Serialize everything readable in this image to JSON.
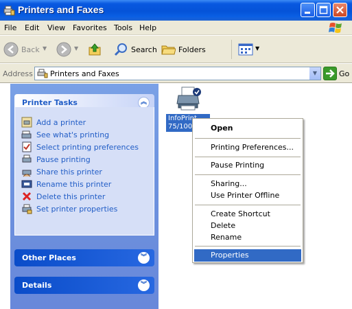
{
  "window": {
    "title": "Printers and Faxes",
    "icon": "printer-fax-icon"
  },
  "menu": {
    "items": [
      "File",
      "Edit",
      "View",
      "Favorites",
      "Tools",
      "Help"
    ]
  },
  "toolbar": {
    "back_label": "Back",
    "search_label": "Search",
    "folders_label": "Folders"
  },
  "address": {
    "label": "Address",
    "value": "Printers and Faxes",
    "go_label": "Go"
  },
  "left_panel": {
    "printer_tasks": {
      "title": "Printer Tasks",
      "items": [
        {
          "label": "Add a printer",
          "icon": "add-printer-icon"
        },
        {
          "label": "See what's printing",
          "icon": "print-queue-icon"
        },
        {
          "label": "Select printing preferences",
          "icon": "preferences-icon"
        },
        {
          "label": "Pause printing",
          "icon": "pause-printer-icon"
        },
        {
          "label": "Share this printer",
          "icon": "share-printer-icon"
        },
        {
          "label": "Rename this printer",
          "icon": "rename-icon"
        },
        {
          "label": "Delete this printer",
          "icon": "delete-x-icon"
        },
        {
          "label": "Set printer properties",
          "icon": "printer-properties-icon"
        }
      ]
    },
    "other_places": {
      "title": "Other Places"
    },
    "details": {
      "title": "Details"
    }
  },
  "content": {
    "printer": {
      "label_line1": "InfoPrint",
      "label_line2": "75/100 P",
      "icon": "printer-icon",
      "status": "default-printer-check-icon"
    }
  },
  "context_menu": {
    "items": [
      "Open",
      "Printing Preferences...",
      "Pause Printing",
      "Sharing...",
      "Use Printer Offline",
      "Create Shortcut",
      "Delete",
      "Rename",
      "Properties"
    ],
    "selected": "Properties"
  },
  "colors": {
    "title_bar": "#0553d8",
    "selection": "#316ac5",
    "task_link": "#215dc6",
    "task_pane": "#6e93df"
  }
}
